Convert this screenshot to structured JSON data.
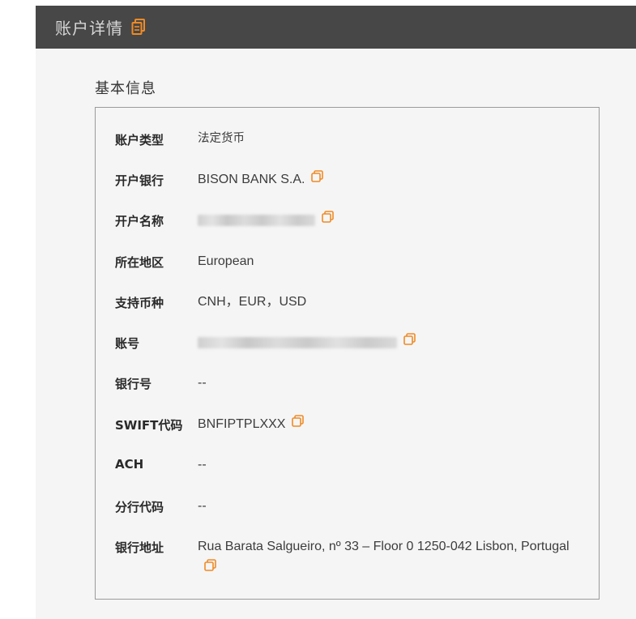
{
  "header": {
    "title": "账户详情",
    "copy_icon": "copy-icon"
  },
  "section": {
    "title": "基本信息"
  },
  "rows": [
    {
      "label": "账户类型",
      "value": "法定货币"
    },
    {
      "label": "开户银行",
      "value": "BISON BANK S.A."
    },
    {
      "label": "开户名称",
      "value": ""
    },
    {
      "label": "所在地区",
      "value": "European"
    },
    {
      "label": "支持币种",
      "value": "CNH，EUR，USD"
    },
    {
      "label": "账号",
      "value": ""
    },
    {
      "label": "银行号",
      "value": "--"
    },
    {
      "label": "SWIFT代码",
      "value": "BNFIPTPLXXX"
    },
    {
      "label": "ACH",
      "value": "--"
    },
    {
      "label": "分行代码",
      "value": "--"
    },
    {
      "label": "银行地址",
      "value": "Rua Barata Salgueiro, nº 33 – Floor 0 1250-042 Lisbon, Portugal"
    }
  ],
  "colors": {
    "header_bg": "#474747",
    "accent": "#f08a24",
    "page_bg": "#f5f5f5",
    "panel_border": "#9a9a9a"
  }
}
